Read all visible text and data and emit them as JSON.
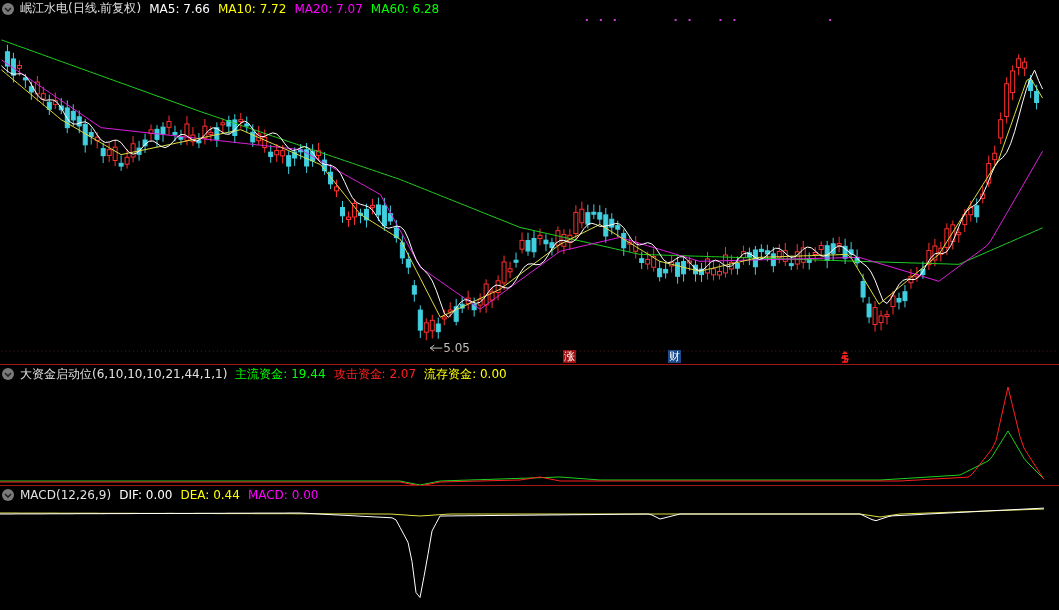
{
  "price_panel": {
    "title": "岷江水电(日线.前复权)",
    "indicators": [
      {
        "label": "MA5: 7.66",
        "color": "#ffffff"
      },
      {
        "label": "MA10: 7.72",
        "color": "#ffff00"
      },
      {
        "label": "MA20: 7.07",
        "color": "#ff00ff"
      },
      {
        "label": "MA60: 6.28",
        "color": "#00ff00"
      }
    ],
    "low_label": "5.05",
    "markers": [
      {
        "kind": "text",
        "text": "涨",
        "color": "#a01010"
      },
      {
        "kind": "text",
        "text": "财",
        "color": "#1a4a8a"
      },
      {
        "kind": "icon",
        "color": "#ff2020"
      }
    ]
  },
  "fund_panel": {
    "title": "大资金启动位(6,10,10,10,21,44,1,1)",
    "indicators": [
      {
        "label": "主流资金: 19.44",
        "color": "#00ff00"
      },
      {
        "label": "攻击资金: 2.07",
        "color": "#ff2020"
      },
      {
        "label": "流存资金: 0.00",
        "color": "#ffff00"
      }
    ]
  },
  "macd_panel": {
    "title": "MACD(12,26,9)",
    "indicators": [
      {
        "label": "DIF: 0.00",
        "color": "#ffffff"
      },
      {
        "label": "DEA: 0.44",
        "color": "#ffff00"
      },
      {
        "label": "MACD: 0.00",
        "color": "#ff00ff"
      }
    ]
  }
}
